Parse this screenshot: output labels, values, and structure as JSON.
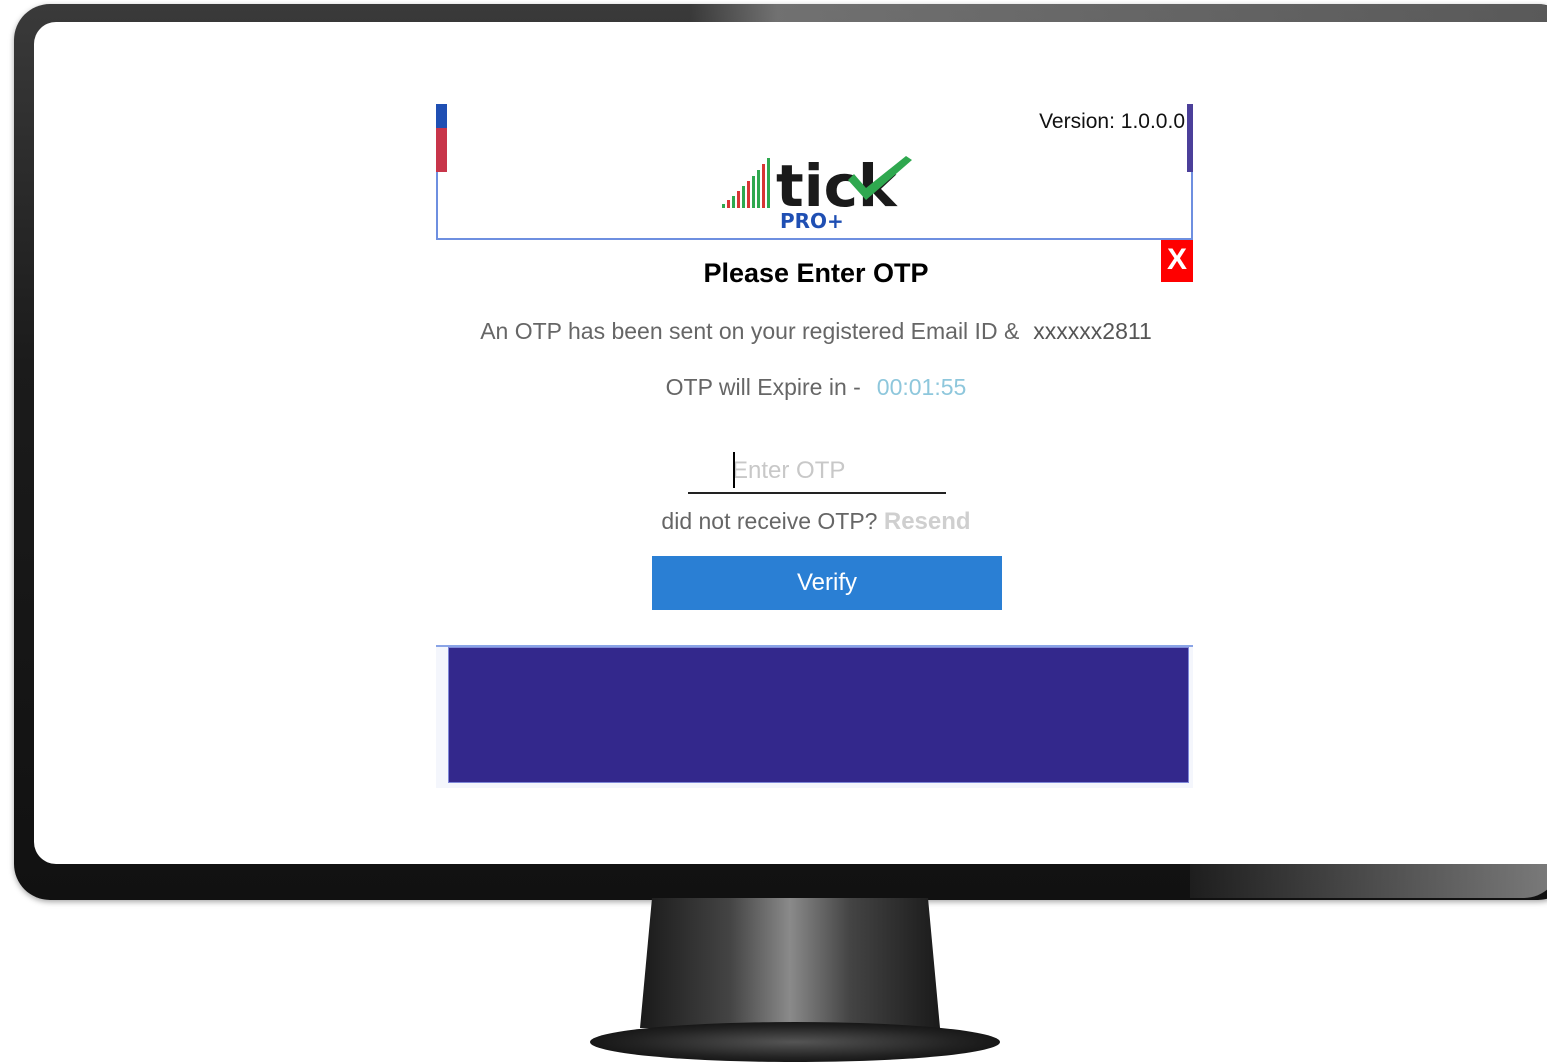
{
  "header": {
    "version_text": "Version: 1.0.0.0",
    "logo": {
      "word": "tick",
      "subtitle": "PRO+",
      "icon": "green-checkmark-icon"
    }
  },
  "dialog": {
    "close_label": "X",
    "title": "Please Enter OTP",
    "sent_message": "An OTP has been sent on your registered Email ID &",
    "masked_contact": "xxxxxx2811",
    "expire_label": "OTP will Expire in -",
    "expire_timer": "00:01:55",
    "otp_input": {
      "value": "",
      "placeholder": "Enter OTP"
    },
    "resend_prompt": "did not receive OTP?",
    "resend_label": "Resend",
    "verify_label": "Verify"
  },
  "colors": {
    "verify_button": "#2a7fd4",
    "close_button": "#ff0000",
    "timer": "#8ec7dc",
    "banner": "#33288c",
    "logo_green": "#2fa84f",
    "logo_blue": "#1f4fb3"
  }
}
